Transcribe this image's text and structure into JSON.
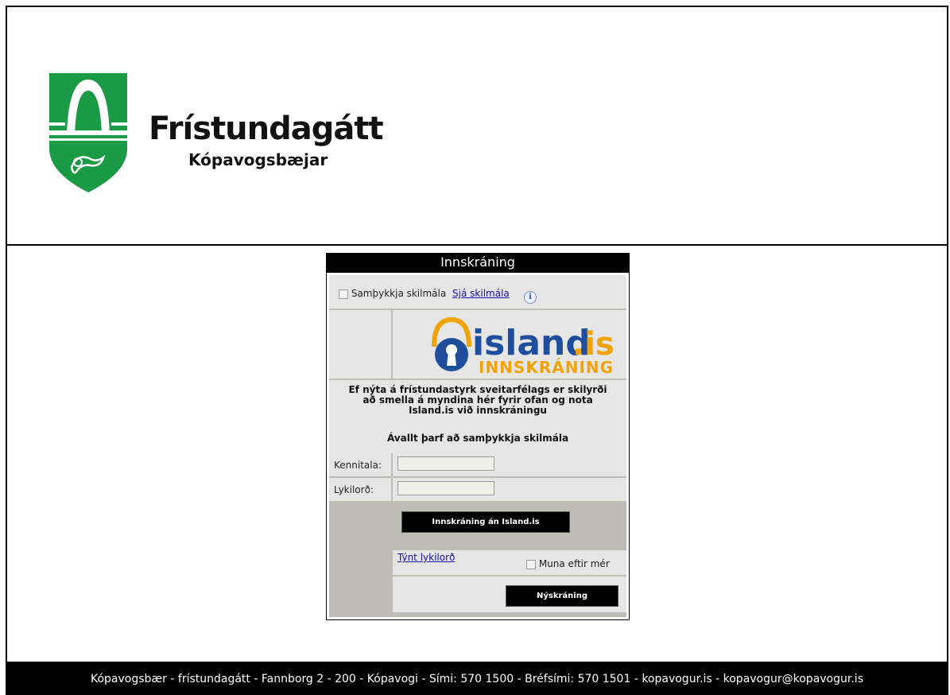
{
  "brand": {
    "title": "Frístundagátt",
    "subtitle": "Kópavogsbæjar",
    "colors": {
      "green": "#1a9a45"
    }
  },
  "login": {
    "title": "Innskráning",
    "accept_terms_label": "Samþykkja skilmála",
    "see_terms_link": "Sjá skilmála",
    "island_logo": {
      "word": "island",
      "suffix": ".is",
      "tagline": "INNSKRÁNING",
      "colors": {
        "blue": "#1f4e9c",
        "orange": "#f0a30a"
      }
    },
    "info_text": "Ef nýta á frístundastyrk sveitarfélags er skilyrði að smella á myndina hér fyrir ofan og nota Island.is við innskráningu",
    "always_text": "Ávallt þarf að samþykkja skilmála",
    "kennitala_label": "Kennitala:",
    "kennitala_value": "",
    "password_label": "Lykilorð:",
    "password_value": "",
    "login_without_button": "Innskráning án Island.is",
    "forgot_password_link": "Týnt lykilorð",
    "remember_me_label": "Muna eftir mér",
    "register_button": "Nýskráning"
  },
  "footer": {
    "text": "Kópavogsbær - frístundagátt - Fannborg 2 - 200 - Kópavogi - Sími: 570 1500 - Bréfsími: 570 1501 - kopavogur.is - kopavogur@kopavogur.is"
  }
}
